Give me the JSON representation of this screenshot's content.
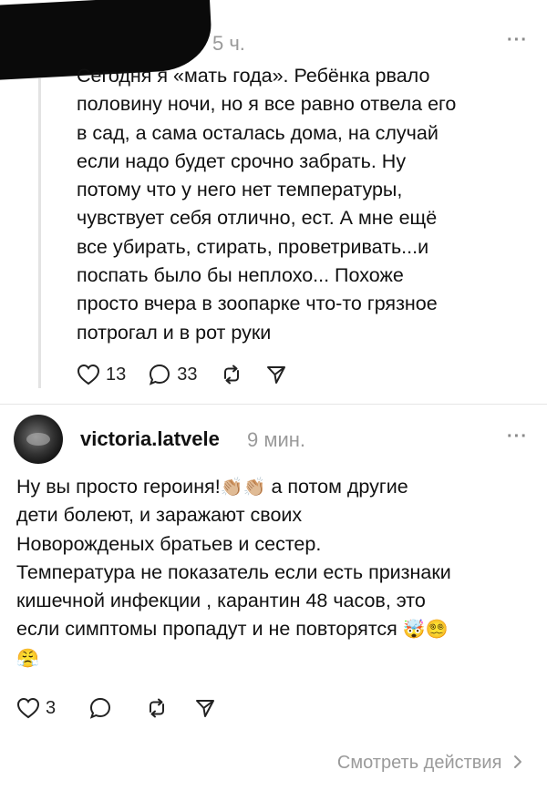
{
  "post": {
    "time": "5 ч.",
    "more": "···",
    "text": "Сегодня я «мать года». Ребёнка рвало\nполовину ночи, но я все равно отвела его\nв сад, а сама осталась дома, на случай\nесли надо будет срочно забрать. Ну\nпотому что у него нет температуры,\nчувствует себя отлично, ест. А мне ещё\nвсе убирать, стирать, проветривать...и\nпоспать было бы неплохо... Похоже\nпросто вчера в зоопарке что-то грязное\nпотрогал и в рот руки",
    "likes": "13",
    "comments": "33"
  },
  "reply": {
    "username": "victoria.latvele",
    "time": "9 мин.",
    "more": "···",
    "text_line1_a": "Ну вы просто героиня!",
    "text_line1_emoji": "👏🏼👏🏼",
    "text_line1_b": " а потом другие",
    "text_rest": "дети болеют, и заражают своих\nНоворожденых братьев и сестер.\nТемпература не показатель если есть признаки\nкишечной инфекции , карантин 48 часов, это\nесли симптомы пропадут и не повторятся",
    "text_end_emoji": "🤯😵‍💫",
    "last_line_emoji": "😤",
    "likes": "3"
  },
  "footer": {
    "link": "Смотреть действия"
  }
}
